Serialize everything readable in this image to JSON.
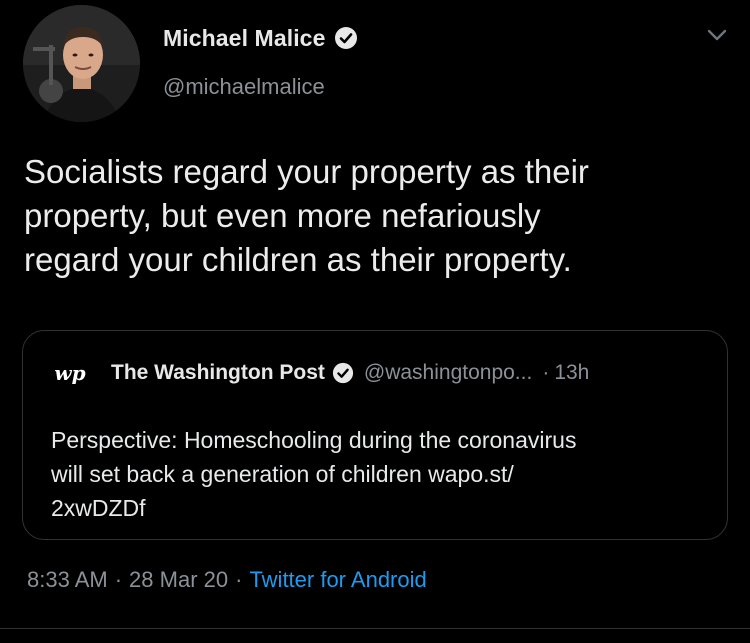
{
  "author": {
    "name": "Michael Malice",
    "handle": "@michaelmalice",
    "verified": true
  },
  "tweet": {
    "text": "Socialists regard your property as their\nproperty, but even more nefariously\nregard your children as their property."
  },
  "quote": {
    "logo_icon": "washington-post-logo",
    "name": "The Washington Post",
    "verified": true,
    "handle": "@washingtonpo...",
    "separator": "·",
    "time": "13h",
    "text": "Perspective: Homeschooling during the coronavirus\nwill set back a generation of children wapo.st/\n2xwDZDf"
  },
  "meta": {
    "time": "8:33 AM",
    "date": "28 Mar 20",
    "source": "Twitter for Android",
    "separator": "·"
  },
  "icons": {
    "verified": "verified-badge-icon",
    "more": "chevron-down-icon"
  },
  "colors": {
    "background": "#000000",
    "primary_text": "#e7e9ea",
    "secondary_text": "#8b9197",
    "link": "#1d9bf0",
    "border": "#2f3336"
  }
}
